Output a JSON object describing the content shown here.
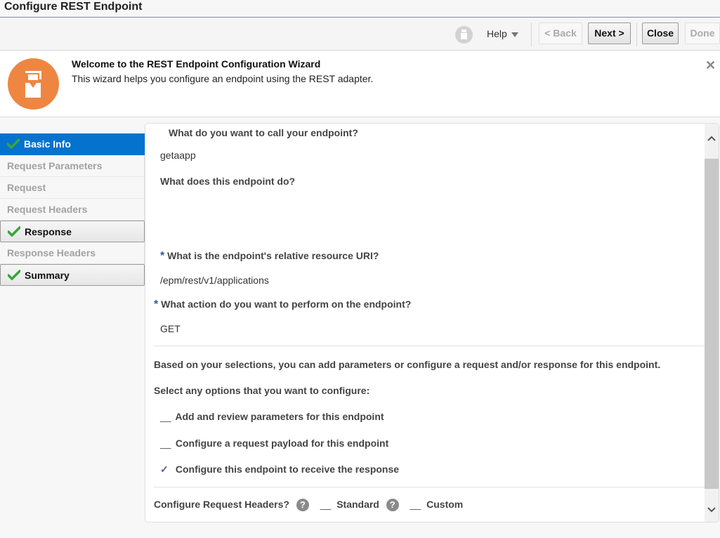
{
  "window": {
    "title": "Configure REST Endpoint"
  },
  "toolbar": {
    "help_label": "Help",
    "back_label": "< Back",
    "next_label": "Next >",
    "close_label": "Close",
    "done_label": "Done"
  },
  "welcome": {
    "title": "Welcome to the REST Endpoint Configuration Wizard",
    "subtitle": "This wizard helps you configure an endpoint using the REST adapter.",
    "close_glyph": "✕"
  },
  "steps": [
    {
      "label": "Basic Info",
      "state": "current",
      "checked": true
    },
    {
      "label": "Request Parameters",
      "state": "disabled",
      "checked": false
    },
    {
      "label": "Request",
      "state": "disabled",
      "checked": false
    },
    {
      "label": "Request Headers",
      "state": "disabled",
      "checked": false
    },
    {
      "label": "Response",
      "state": "done",
      "checked": true
    },
    {
      "label": "Response Headers",
      "state": "disabled",
      "checked": false
    },
    {
      "label": "Summary",
      "state": "done",
      "checked": true
    }
  ],
  "form": {
    "name_question": "What do you want to call your endpoint?",
    "name_value": "getaapp",
    "desc_question": "What does this endpoint do?",
    "desc_value": "",
    "uri_required_mark": "*",
    "uri_question": "What is the endpoint's relative resource URI?",
    "uri_value": "/epm/rest/v1/applications",
    "action_required_mark": "*",
    "action_question": "What action do you want to perform on the endpoint?",
    "action_value": "GET",
    "based_text": "Based on your selections, you can add parameters or configure a request and/or response for this endpoint.",
    "select_text": "Select any options that you want to configure:",
    "options": [
      {
        "label": "Add and review parameters for this endpoint",
        "checked": false,
        "mark": "__"
      },
      {
        "label": "Configure a request payload for this endpoint",
        "checked": false,
        "mark": "__"
      },
      {
        "label": "Configure this endpoint to receive the response",
        "checked": true,
        "mark": "✓"
      }
    ],
    "headers_question": "Configure Request Headers?",
    "headers_help_glyph": "?",
    "headers_standard_mark": "__",
    "headers_standard_label": "Standard",
    "headers_custom_mark": "__",
    "headers_custom_label": "Custom"
  },
  "colors": {
    "accent": "#0572ce",
    "logo": "#ee8641",
    "check": "#3aa53a"
  }
}
